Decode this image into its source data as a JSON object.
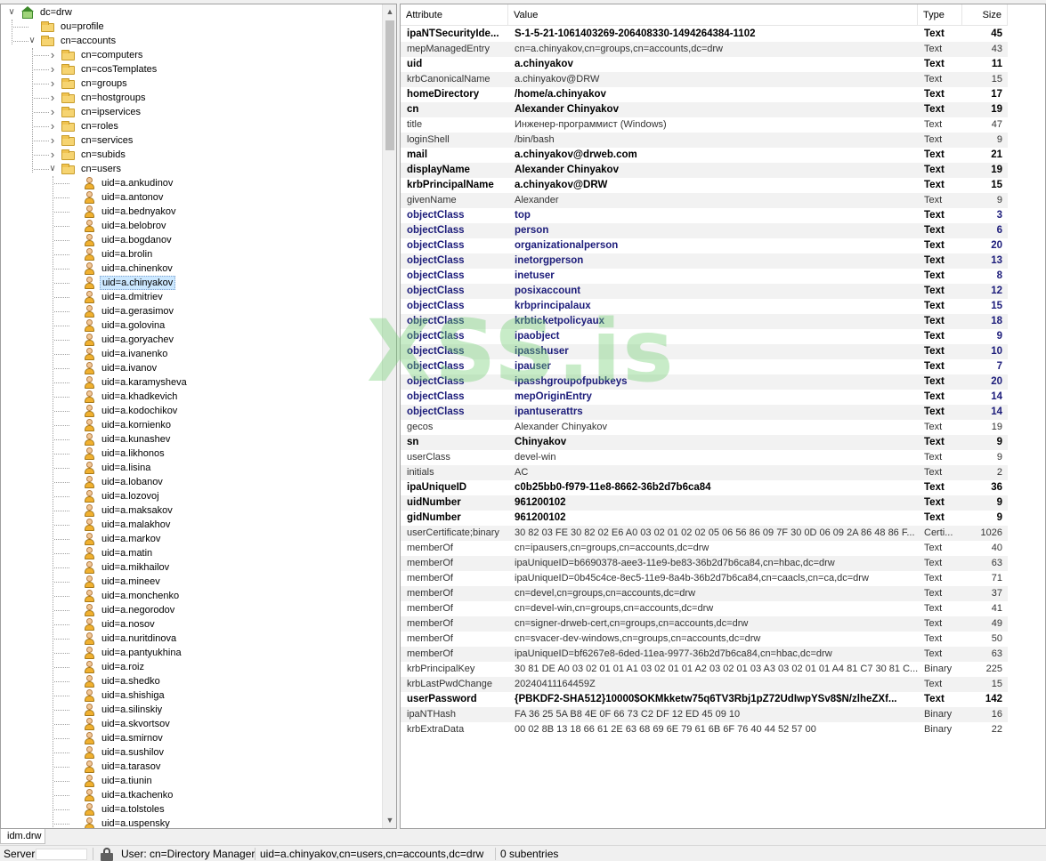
{
  "tree": {
    "root": "dc=drw",
    "nodes": [
      {
        "label": "dc=drw",
        "level": 0,
        "icon": "root",
        "toggle": "open"
      },
      {
        "label": "ou=profile",
        "level": 1,
        "icon": "folder",
        "toggle": "none"
      },
      {
        "label": "cn=accounts",
        "level": 1,
        "icon": "folder",
        "toggle": "open"
      },
      {
        "label": "cn=computers",
        "level": 2,
        "icon": "folder",
        "toggle": "closed"
      },
      {
        "label": "cn=cosTemplates",
        "level": 2,
        "icon": "folder",
        "toggle": "closed"
      },
      {
        "label": "cn=groups",
        "level": 2,
        "icon": "folder",
        "toggle": "closed"
      },
      {
        "label": "cn=hostgroups",
        "level": 2,
        "icon": "folder",
        "toggle": "closed"
      },
      {
        "label": "cn=ipservices",
        "level": 2,
        "icon": "folder",
        "toggle": "closed"
      },
      {
        "label": "cn=roles",
        "level": 2,
        "icon": "folder",
        "toggle": "closed"
      },
      {
        "label": "cn=services",
        "level": 2,
        "icon": "folder",
        "toggle": "closed"
      },
      {
        "label": "cn=subids",
        "level": 2,
        "icon": "folder",
        "toggle": "closed"
      },
      {
        "label": "cn=users",
        "level": 2,
        "icon": "folder",
        "toggle": "open"
      },
      {
        "label": "uid=a.ankudinov",
        "level": 3,
        "icon": "user",
        "toggle": "none"
      },
      {
        "label": "uid=a.antonov",
        "level": 3,
        "icon": "user",
        "toggle": "none"
      },
      {
        "label": "uid=a.bednyakov",
        "level": 3,
        "icon": "user",
        "toggle": "none"
      },
      {
        "label": "uid=a.belobrov",
        "level": 3,
        "icon": "user",
        "toggle": "none"
      },
      {
        "label": "uid=a.bogdanov",
        "level": 3,
        "icon": "user",
        "toggle": "none"
      },
      {
        "label": "uid=a.brolin",
        "level": 3,
        "icon": "user",
        "toggle": "none"
      },
      {
        "label": "uid=a.chinenkov",
        "level": 3,
        "icon": "user",
        "toggle": "none"
      },
      {
        "label": "uid=a.chinyakov",
        "level": 3,
        "icon": "user",
        "toggle": "none",
        "selected": true
      },
      {
        "label": "uid=a.dmitriev",
        "level": 3,
        "icon": "user",
        "toggle": "none"
      },
      {
        "label": "uid=a.gerasimov",
        "level": 3,
        "icon": "user",
        "toggle": "none"
      },
      {
        "label": "uid=a.golovina",
        "level": 3,
        "icon": "user",
        "toggle": "none"
      },
      {
        "label": "uid=a.goryachev",
        "level": 3,
        "icon": "user",
        "toggle": "none"
      },
      {
        "label": "uid=a.ivanenko",
        "level": 3,
        "icon": "user",
        "toggle": "none"
      },
      {
        "label": "uid=a.ivanov",
        "level": 3,
        "icon": "user",
        "toggle": "none"
      },
      {
        "label": "uid=a.karamysheva",
        "level": 3,
        "icon": "user",
        "toggle": "none"
      },
      {
        "label": "uid=a.khadkevich",
        "level": 3,
        "icon": "user",
        "toggle": "none"
      },
      {
        "label": "uid=a.kodochikov",
        "level": 3,
        "icon": "user",
        "toggle": "none"
      },
      {
        "label": "uid=a.kornienko",
        "level": 3,
        "icon": "user",
        "toggle": "none"
      },
      {
        "label": "uid=a.kunashev",
        "level": 3,
        "icon": "user",
        "toggle": "none"
      },
      {
        "label": "uid=a.likhonos",
        "level": 3,
        "icon": "user",
        "toggle": "none"
      },
      {
        "label": "uid=a.lisina",
        "level": 3,
        "icon": "user",
        "toggle": "none"
      },
      {
        "label": "uid=a.lobanov",
        "level": 3,
        "icon": "user",
        "toggle": "none"
      },
      {
        "label": "uid=a.lozovoj",
        "level": 3,
        "icon": "user",
        "toggle": "none"
      },
      {
        "label": "uid=a.maksakov",
        "level": 3,
        "icon": "user",
        "toggle": "none"
      },
      {
        "label": "uid=a.malakhov",
        "level": 3,
        "icon": "user",
        "toggle": "none"
      },
      {
        "label": "uid=a.markov",
        "level": 3,
        "icon": "user",
        "toggle": "none"
      },
      {
        "label": "uid=a.matin",
        "level": 3,
        "icon": "user",
        "toggle": "none"
      },
      {
        "label": "uid=a.mikhailov",
        "level": 3,
        "icon": "user",
        "toggle": "none"
      },
      {
        "label": "uid=a.mineev",
        "level": 3,
        "icon": "user",
        "toggle": "none"
      },
      {
        "label": "uid=a.monchenko",
        "level": 3,
        "icon": "user",
        "toggle": "none"
      },
      {
        "label": "uid=a.negorodov",
        "level": 3,
        "icon": "user",
        "toggle": "none"
      },
      {
        "label": "uid=a.nosov",
        "level": 3,
        "icon": "user",
        "toggle": "none"
      },
      {
        "label": "uid=a.nuritdinova",
        "level": 3,
        "icon": "user",
        "toggle": "none"
      },
      {
        "label": "uid=a.pantyukhina",
        "level": 3,
        "icon": "user",
        "toggle": "none"
      },
      {
        "label": "uid=a.roiz",
        "level": 3,
        "icon": "user",
        "toggle": "none"
      },
      {
        "label": "uid=a.shedko",
        "level": 3,
        "icon": "user",
        "toggle": "none"
      },
      {
        "label": "uid=a.shishiga",
        "level": 3,
        "icon": "user",
        "toggle": "none"
      },
      {
        "label": "uid=a.silinskiy",
        "level": 3,
        "icon": "user",
        "toggle": "none"
      },
      {
        "label": "uid=a.skvortsov",
        "level": 3,
        "icon": "user",
        "toggle": "none"
      },
      {
        "label": "uid=a.smirnov",
        "level": 3,
        "icon": "user",
        "toggle": "none"
      },
      {
        "label": "uid=a.sushilov",
        "level": 3,
        "icon": "user",
        "toggle": "none"
      },
      {
        "label": "uid=a.tarasov",
        "level": 3,
        "icon": "user",
        "toggle": "none"
      },
      {
        "label": "uid=a.tiunin",
        "level": 3,
        "icon": "user",
        "toggle": "none"
      },
      {
        "label": "uid=a.tkachenko",
        "level": 3,
        "icon": "user",
        "toggle": "none"
      },
      {
        "label": "uid=a.tolstoles",
        "level": 3,
        "icon": "user",
        "toggle": "none"
      },
      {
        "label": "uid=a.uspensky",
        "level": 3,
        "icon": "user",
        "toggle": "none"
      }
    ]
  },
  "grid": {
    "columns": {
      "attribute": "Attribute",
      "value": "Value",
      "type": "Type",
      "size": "Size"
    },
    "rows": [
      {
        "attr": "ipaNTSecurityIde...",
        "value": "S-1-5-21-1061403269-206408330-1494264384-1102",
        "type": "Text",
        "size": "45",
        "style": "bold"
      },
      {
        "attr": "mepManagedEntry",
        "value": "cn=a.chinyakov,cn=groups,cn=accounts,dc=drw",
        "type": "Text",
        "size": "43",
        "style": "normal"
      },
      {
        "attr": "uid",
        "value": "a.chinyakov",
        "type": "Text",
        "size": "11",
        "style": "bold"
      },
      {
        "attr": "krbCanonicalName",
        "value": "a.chinyakov@DRW",
        "type": "Text",
        "size": "15",
        "style": "normal"
      },
      {
        "attr": "homeDirectory",
        "value": "/home/a.chinyakov",
        "type": "Text",
        "size": "17",
        "style": "bold"
      },
      {
        "attr": "cn",
        "value": "Alexander Chinyakov",
        "type": "Text",
        "size": "19",
        "style": "bold"
      },
      {
        "attr": "title",
        "value": "Инженер-программист (Windows)",
        "type": "Text",
        "size": "47",
        "style": "normal"
      },
      {
        "attr": "loginShell",
        "value": "/bin/bash",
        "type": "Text",
        "size": "9",
        "style": "normal"
      },
      {
        "attr": "mail",
        "value": "a.chinyakov@drweb.com",
        "type": "Text",
        "size": "21",
        "style": "bold"
      },
      {
        "attr": "displayName",
        "value": "Alexander Chinyakov",
        "type": "Text",
        "size": "19",
        "style": "bold"
      },
      {
        "attr": "krbPrincipalName",
        "value": "a.chinyakov@DRW",
        "type": "Text",
        "size": "15",
        "style": "bold"
      },
      {
        "attr": "givenName",
        "value": "Alexander",
        "type": "Text",
        "size": "9",
        "style": "normal"
      },
      {
        "attr": "objectClass",
        "value": "top",
        "type": "Text",
        "size": "3",
        "style": "oc"
      },
      {
        "attr": "objectClass",
        "value": "person",
        "type": "Text",
        "size": "6",
        "style": "oc"
      },
      {
        "attr": "objectClass",
        "value": "organizationalperson",
        "type": "Text",
        "size": "20",
        "style": "oc"
      },
      {
        "attr": "objectClass",
        "value": "inetorgperson",
        "type": "Text",
        "size": "13",
        "style": "oc"
      },
      {
        "attr": "objectClass",
        "value": "inetuser",
        "type": "Text",
        "size": "8",
        "style": "oc"
      },
      {
        "attr": "objectClass",
        "value": "posixaccount",
        "type": "Text",
        "size": "12",
        "style": "oc"
      },
      {
        "attr": "objectClass",
        "value": "krbprincipalaux",
        "type": "Text",
        "size": "15",
        "style": "oc"
      },
      {
        "attr": "objectClass",
        "value": "krbticketpolicyaux",
        "type": "Text",
        "size": "18",
        "style": "oc"
      },
      {
        "attr": "objectClass",
        "value": "ipaobject",
        "type": "Text",
        "size": "9",
        "style": "oc"
      },
      {
        "attr": "objectClass",
        "value": "ipasshuser",
        "type": "Text",
        "size": "10",
        "style": "oc"
      },
      {
        "attr": "objectClass",
        "value": "ipauser",
        "type": "Text",
        "size": "7",
        "style": "oc"
      },
      {
        "attr": "objectClass",
        "value": "ipasshgroupofpubkeys",
        "type": "Text",
        "size": "20",
        "style": "oc"
      },
      {
        "attr": "objectClass",
        "value": "mepOriginEntry",
        "type": "Text",
        "size": "14",
        "style": "oc"
      },
      {
        "attr": "objectClass",
        "value": "ipantuserattrs",
        "type": "Text",
        "size": "14",
        "style": "oc"
      },
      {
        "attr": "gecos",
        "value": "Alexander Chinyakov",
        "type": "Text",
        "size": "19",
        "style": "normal"
      },
      {
        "attr": "sn",
        "value": "Chinyakov",
        "type": "Text",
        "size": "9",
        "style": "bold"
      },
      {
        "attr": "userClass",
        "value": "devel-win",
        "type": "Text",
        "size": "9",
        "style": "normal"
      },
      {
        "attr": "initials",
        "value": "AC",
        "type": "Text",
        "size": "2",
        "style": "normal"
      },
      {
        "attr": "ipaUniqueID",
        "value": "c0b25bb0-f979-11e8-8662-36b2d7b6ca84",
        "type": "Text",
        "size": "36",
        "style": "bold"
      },
      {
        "attr": "uidNumber",
        "value": "961200102",
        "type": "Text",
        "size": "9",
        "style": "bold"
      },
      {
        "attr": "gidNumber",
        "value": "961200102",
        "type": "Text",
        "size": "9",
        "style": "bold"
      },
      {
        "attr": "userCertificate;binary",
        "value": "30 82 03 FE 30 82 02 E6 A0 03 02 01 02 02 05 06 56 86 09 7F 30 0D 06 09 2A 86 48 86 F...",
        "type": "Certi...",
        "size": "1026",
        "style": "normal"
      },
      {
        "attr": "memberOf",
        "value": "cn=ipausers,cn=groups,cn=accounts,dc=drw",
        "type": "Text",
        "size": "40",
        "style": "normal"
      },
      {
        "attr": "memberOf",
        "value": "ipaUniqueID=b6690378-aee3-11e9-be83-36b2d7b6ca84,cn=hbac,dc=drw",
        "type": "Text",
        "size": "63",
        "style": "normal"
      },
      {
        "attr": "memberOf",
        "value": "ipaUniqueID=0b45c4ce-8ec5-11e9-8a4b-36b2d7b6ca84,cn=caacls,cn=ca,dc=drw",
        "type": "Text",
        "size": "71",
        "style": "normal"
      },
      {
        "attr": "memberOf",
        "value": "cn=devel,cn=groups,cn=accounts,dc=drw",
        "type": "Text",
        "size": "37",
        "style": "normal"
      },
      {
        "attr": "memberOf",
        "value": "cn=devel-win,cn=groups,cn=accounts,dc=drw",
        "type": "Text",
        "size": "41",
        "style": "normal"
      },
      {
        "attr": "memberOf",
        "value": "cn=signer-drweb-cert,cn=groups,cn=accounts,dc=drw",
        "type": "Text",
        "size": "49",
        "style": "normal"
      },
      {
        "attr": "memberOf",
        "value": "cn=svacer-dev-windows,cn=groups,cn=accounts,dc=drw",
        "type": "Text",
        "size": "50",
        "style": "normal"
      },
      {
        "attr": "memberOf",
        "value": "ipaUniqueID=bf6267e8-6ded-11ea-9977-36b2d7b6ca84,cn=hbac,dc=drw",
        "type": "Text",
        "size": "63",
        "style": "normal"
      },
      {
        "attr": "krbPrincipalKey",
        "value": "30 81 DE A0 03 02 01 01 A1 03 02 01 01 A2 03 02 01 03 A3 03 02 01 01 A4 81 C7 30 81 C...",
        "type": "Binary",
        "size": "225",
        "style": "normal"
      },
      {
        "attr": "krbLastPwdChange",
        "value": "20240411164459Z",
        "type": "Text",
        "size": "15",
        "style": "normal"
      },
      {
        "attr": "userPassword",
        "value": "{PBKDF2-SHA512}10000$OKMkketw75q6TV3Rbj1pZ72UdIwpYSv8$N/zlheZXf...",
        "type": "Text",
        "size": "142",
        "style": "bold"
      },
      {
        "attr": "ipaNTHash",
        "value": "FA 36 25 5A B8 4E 0F 66 73 C2 DF 12 ED 45 09 10",
        "type": "Binary",
        "size": "16",
        "style": "normal"
      },
      {
        "attr": "krbExtraData",
        "value": "00 02 8B 13 18 66 61 2E 63 68 69 6E 79 61 6B 6F 76 40 44 52 57 00",
        "type": "Binary",
        "size": "22",
        "style": "normal"
      }
    ]
  },
  "watermark": "XSS.is",
  "tabs": {
    "connection": "idm.drw"
  },
  "status": {
    "server_label": "Server:",
    "user": "User: cn=Directory Manager",
    "dn": "uid=a.chinyakov,cn=users,cn=accounts,dc=drw",
    "subentries": "0 subentries"
  },
  "colors": {
    "objectclass_text": "#1c1c7a",
    "selection": "#cce8ff",
    "watermark": "#6ecd6e"
  }
}
